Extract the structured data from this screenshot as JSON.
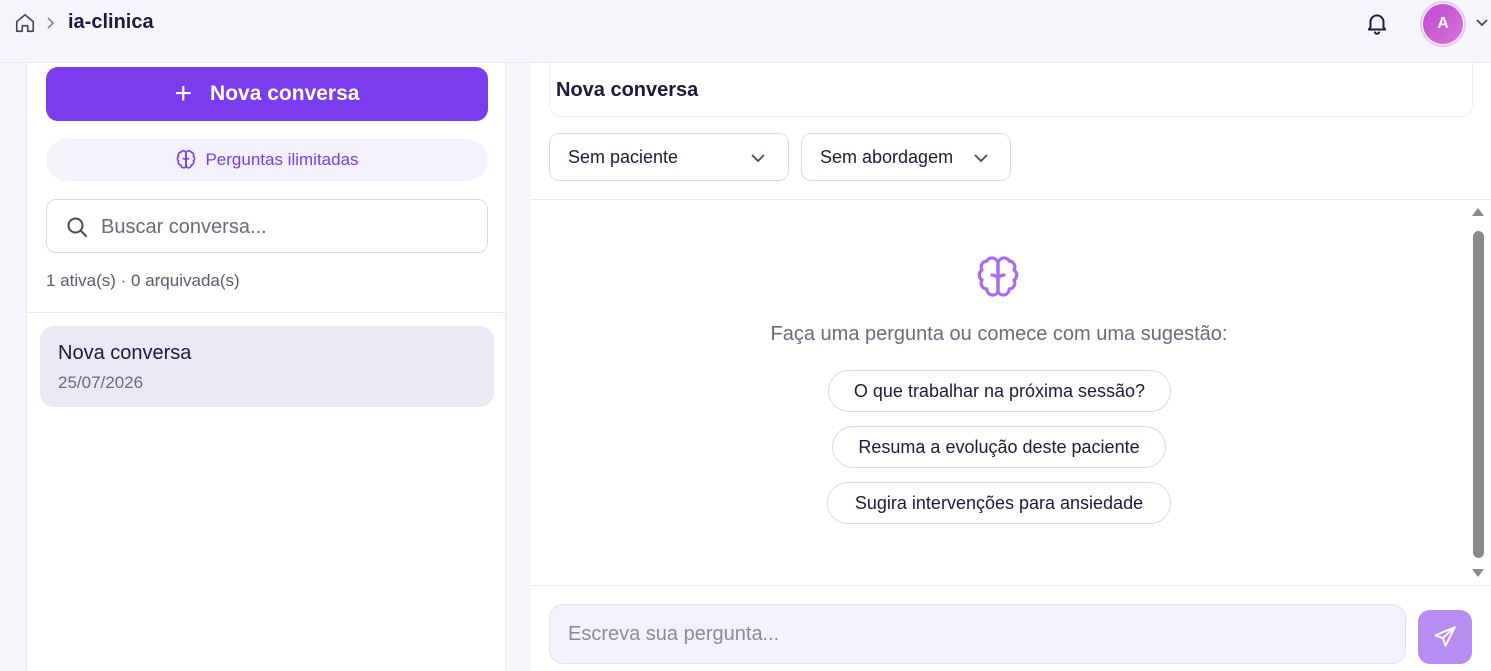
{
  "header": {
    "breadcrumb_home_icon": "home-icon",
    "breadcrumb_separator_icon": "chevron-right-icon",
    "breadcrumb_current": "ia-clinica",
    "notifications_icon": "bell-icon",
    "avatar_initial": "A",
    "avatar_menu_icon": "chevron-down-icon"
  },
  "sidebar": {
    "new_conversation_label": "Nova conversa",
    "new_conversation_icon": "plus-icon",
    "plan_badge_label": "Perguntas ilimitadas",
    "plan_badge_icon": "brain-icon",
    "search": {
      "placeholder": "Buscar conversa...",
      "value": ""
    },
    "counts_label": "1 ativa(s) · 0 arquivada(s)",
    "conversations": [
      {
        "title": "Nova conversa",
        "date": "25/07/2026"
      }
    ]
  },
  "chat": {
    "title": "Nova conversa",
    "patient_select": {
      "selected": "Sem paciente"
    },
    "approach_select": {
      "selected": "Sem abordagem"
    },
    "empty_icon": "brain-icon",
    "empty_prompt": "Faça uma pergunta ou comece com uma sugestão:",
    "suggestions": [
      "O que trabalhar na próxima sessão?",
      "Resuma a evolução deste paciente",
      "Sugira intervenções para ansiedade"
    ],
    "input": {
      "placeholder": "Escreva sua pergunta...",
      "value": ""
    },
    "send_icon": "send-icon"
  },
  "colors": {
    "accent": "#7a3cec",
    "accent_soft": "#b78cf3",
    "avatar": "#c04ad0",
    "selected_conversation_bg": "#ebe8f4"
  }
}
